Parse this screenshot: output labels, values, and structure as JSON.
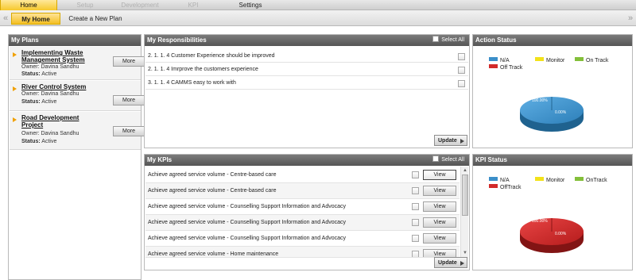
{
  "topnav": {
    "tabs": [
      {
        "label": "Home",
        "state": "active"
      },
      {
        "label": "Setup",
        "state": "dim"
      },
      {
        "label": "Development",
        "state": "dim"
      },
      {
        "label": "KPI",
        "state": "dim"
      },
      {
        "label": "Settings",
        "state": "normal"
      }
    ]
  },
  "subnav": {
    "left_arrow": "«",
    "right_arrow": "»",
    "tabs": [
      {
        "label": "My Home",
        "state": "active"
      },
      {
        "label": "Create a New Plan",
        "state": "normal"
      }
    ]
  },
  "my_plans": {
    "title": "My Plans",
    "more_label": "More",
    "items": [
      {
        "title": "Implementing Waste Management System",
        "owner": "Owner: Davina Sandhu",
        "status_label": "Status:",
        "status_value": "Active"
      },
      {
        "title": "River Control System",
        "owner": "Owner: Davina Sandhu",
        "status_label": "Status:",
        "status_value": "Active"
      },
      {
        "title": "Road Development Project",
        "owner": "Owner: Davina Sandhu",
        "status_label": "Status:",
        "status_value": "Active"
      }
    ]
  },
  "responsibilities": {
    "title": "My Responsibilities",
    "select_all": "Select All",
    "update_label": "Update",
    "items": [
      "2. 1. 1. 4 Customer Experience should be improved",
      "2. 1. 1. 4 Imrprove the customers experience",
      "3. 1. 1. 4 CAMMS easy to work with"
    ]
  },
  "kpis": {
    "title": "My KPIs",
    "select_all": "Select All",
    "update_label": "Update",
    "view_label": "View",
    "items": [
      "Achieve agreed service volume - Centre-based care",
      "Achieve agreed service volume - Centre-based care",
      "Achieve agreed service volume - Counselling Support Information and Advocacy",
      "Achieve agreed service volume - Counselling Support Information and Advocacy",
      "Achieve agreed service volume - Counselling Support Information and Advocacy",
      "Achieve agreed service volume - Home maintenance"
    ]
  },
  "action_status": {
    "title": "Action Status",
    "legend": [
      {
        "label": "N/A",
        "color": "#3b8fc9"
      },
      {
        "label": "Monitor",
        "color": "#f2e21a"
      },
      {
        "label": "On Track",
        "color": "#84bf3a"
      },
      {
        "label": "Off Track",
        "color": "#d22a2a"
      }
    ],
    "chart_data": {
      "type": "pie",
      "slices": [
        {
          "label": "N/A",
          "value": 100.0,
          "color": "#3b8fc9"
        },
        {
          "label": "Off Track",
          "value": 0.0,
          "color": "#d22a2a"
        }
      ],
      "labels": [
        "100.00%",
        "0.00%"
      ]
    }
  },
  "kpi_status": {
    "title": "KPI Status",
    "legend": [
      {
        "label": "N/A",
        "color": "#3b8fc9"
      },
      {
        "label": "Monitor",
        "color": "#f2e21a"
      },
      {
        "label": "OnTrack",
        "color": "#84bf3a"
      },
      {
        "label": "OffTrack",
        "color": "#d22a2a"
      }
    ],
    "chart_data": {
      "type": "pie",
      "slices": [
        {
          "label": "OffTrack",
          "value": 100.0,
          "color": "#d22a2a"
        },
        {
          "label": "N/A",
          "value": 0.0,
          "color": "#3b8fc9"
        }
      ],
      "labels": [
        "100.00%",
        "0.00%"
      ]
    }
  }
}
